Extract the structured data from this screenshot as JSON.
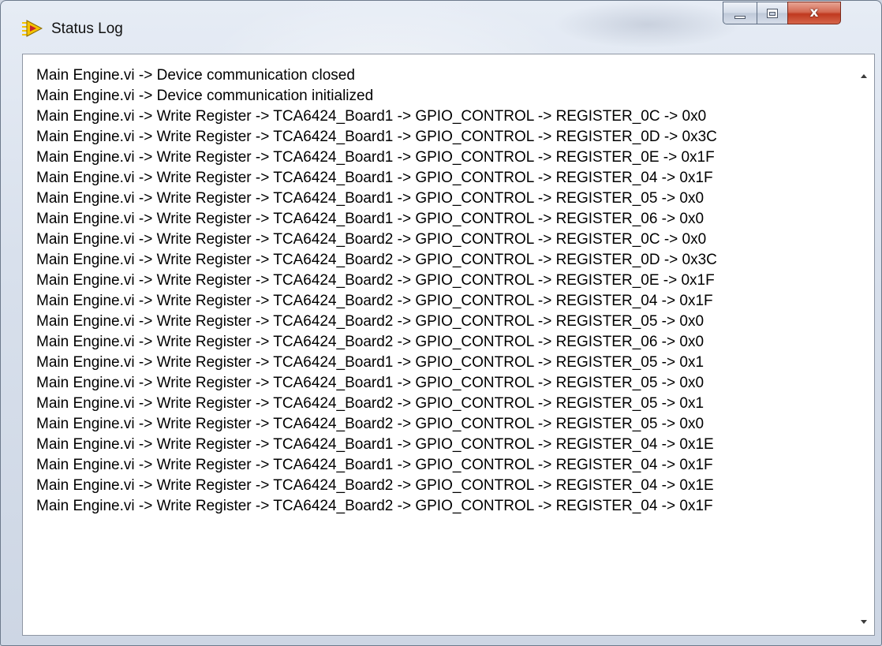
{
  "window": {
    "title": "Status Log",
    "icon": "labview-arrow-icon",
    "close_glyph": "x"
  },
  "colors": {
    "icon_yellow": "#f5c400",
    "icon_red": "#c8242b",
    "close_red": "#c0391f"
  },
  "log": {
    "lines": [
      "Main Engine.vi -> Device communication closed",
      "Main Engine.vi -> Device communication initialized",
      "Main Engine.vi -> Write Register -> TCA6424_Board1 -> GPIO_CONTROL -> REGISTER_0C -> 0x0",
      "Main Engine.vi -> Write Register -> TCA6424_Board1 -> GPIO_CONTROL -> REGISTER_0D -> 0x3C",
      "Main Engine.vi -> Write Register -> TCA6424_Board1 -> GPIO_CONTROL -> REGISTER_0E -> 0x1F",
      "Main Engine.vi -> Write Register -> TCA6424_Board1 -> GPIO_CONTROL -> REGISTER_04 -> 0x1F",
      "Main Engine.vi -> Write Register -> TCA6424_Board1 -> GPIO_CONTROL -> REGISTER_05 -> 0x0",
      "Main Engine.vi -> Write Register -> TCA6424_Board1 -> GPIO_CONTROL -> REGISTER_06 -> 0x0",
      "Main Engine.vi -> Write Register -> TCA6424_Board2 -> GPIO_CONTROL -> REGISTER_0C -> 0x0",
      "Main Engine.vi -> Write Register -> TCA6424_Board2 -> GPIO_CONTROL -> REGISTER_0D -> 0x3C",
      "Main Engine.vi -> Write Register -> TCA6424_Board2 -> GPIO_CONTROL -> REGISTER_0E -> 0x1F",
      "Main Engine.vi -> Write Register -> TCA6424_Board2 -> GPIO_CONTROL -> REGISTER_04 -> 0x1F",
      "Main Engine.vi -> Write Register -> TCA6424_Board2 -> GPIO_CONTROL -> REGISTER_05 -> 0x0",
      "Main Engine.vi -> Write Register -> TCA6424_Board2 -> GPIO_CONTROL -> REGISTER_06 -> 0x0",
      "Main Engine.vi -> Write Register -> TCA6424_Board1 -> GPIO_CONTROL -> REGISTER_05 -> 0x1",
      "Main Engine.vi -> Write Register -> TCA6424_Board1 -> GPIO_CONTROL -> REGISTER_05 -> 0x0",
      "Main Engine.vi -> Write Register -> TCA6424_Board2 -> GPIO_CONTROL -> REGISTER_05 -> 0x1",
      "Main Engine.vi -> Write Register -> TCA6424_Board2 -> GPIO_CONTROL -> REGISTER_05 -> 0x0",
      "Main Engine.vi -> Write Register -> TCA6424_Board1 -> GPIO_CONTROL -> REGISTER_04 -> 0x1E",
      "Main Engine.vi -> Write Register -> TCA6424_Board1 -> GPIO_CONTROL -> REGISTER_04 -> 0x1F",
      "Main Engine.vi -> Write Register -> TCA6424_Board2 -> GPIO_CONTROL -> REGISTER_04 -> 0x1E",
      "Main Engine.vi -> Write Register -> TCA6424_Board2 -> GPIO_CONTROL -> REGISTER_04 -> 0x1F"
    ]
  }
}
